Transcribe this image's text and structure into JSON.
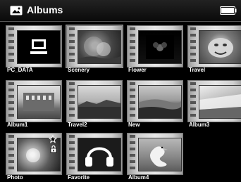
{
  "header": {
    "title": "Albums",
    "title_icon": "photo-album-icon",
    "battery_icon": "battery-full-icon"
  },
  "albums": [
    {
      "label": "PC_DATA",
      "icon": "computer-icon"
    },
    {
      "label": "Scenery"
    },
    {
      "label": "Flower"
    },
    {
      "label": "Travel"
    },
    {
      "label": "Album1"
    },
    {
      "label": "Travel2"
    },
    {
      "label": "New"
    },
    {
      "label": "Album3"
    },
    {
      "label": "Photo",
      "badges": [
        "star-icon",
        "lock-icon"
      ]
    },
    {
      "label": "Favorite",
      "icon": "headphones-icon"
    },
    {
      "label": "Album4"
    }
  ],
  "selected_album": "Scenery",
  "colors": {
    "background": "#000000",
    "text": "#ffffff",
    "frame": "#cfcfcf"
  }
}
